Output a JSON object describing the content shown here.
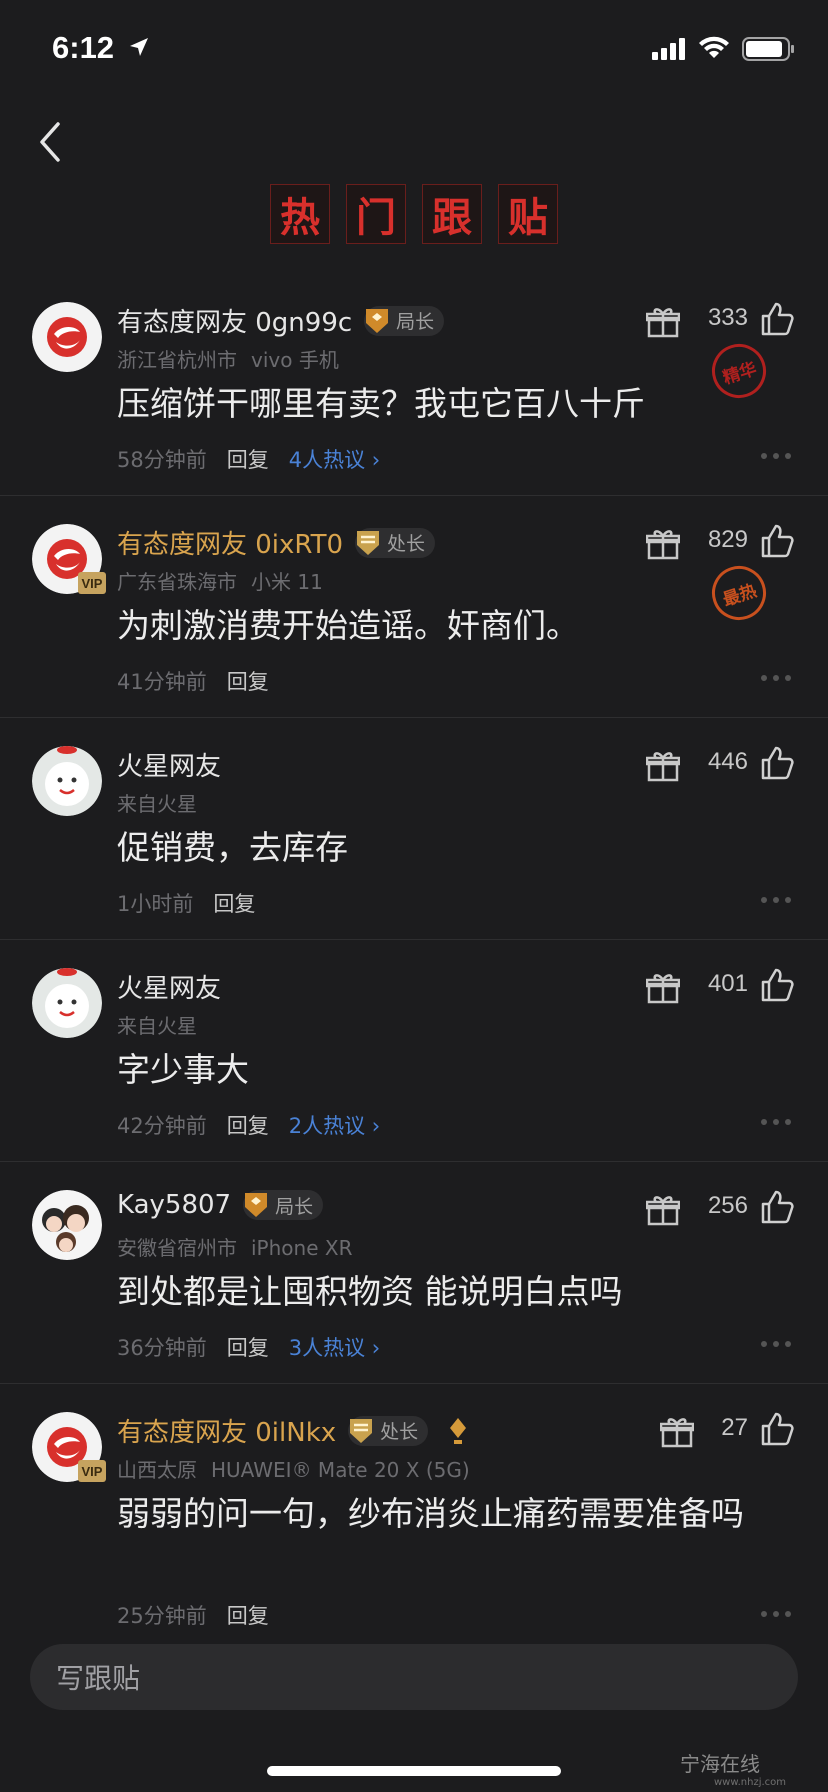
{
  "status_bar": {
    "time": "6:12"
  },
  "page_title_chars": [
    "热",
    "门",
    "跟",
    "贴"
  ],
  "comments": [
    {
      "username": "有态度网友 0gn99c",
      "vip": false,
      "rank": "局长",
      "location": "浙江省杭州市",
      "device": "vivo 手机",
      "text": "压缩饼干哪里有卖？我屯它百八十斤",
      "time": "58分钟前",
      "reply": "回复",
      "hot": "4人热议 ›",
      "likes": "333",
      "stamp": "精华"
    },
    {
      "username": "有态度网友 0ixRT0",
      "vip": true,
      "rank": "处长",
      "location": "广东省珠海市",
      "device": "小米 11",
      "text": "为刺激消费开始造谣。奸商们。",
      "time": "41分钟前",
      "reply": "回复",
      "hot": "",
      "likes": "829",
      "stamp": "最热"
    },
    {
      "username": "火星网友",
      "vip": false,
      "rank": "",
      "location": "来自火星",
      "device": "",
      "text": "促销费，去库存",
      "time": "1小时前",
      "reply": "回复",
      "hot": "",
      "likes": "446",
      "stamp": ""
    },
    {
      "username": "火星网友",
      "vip": false,
      "rank": "",
      "location": "来自火星",
      "device": "",
      "text": "字少事大",
      "time": "42分钟前",
      "reply": "回复",
      "hot": "2人热议 ›",
      "likes": "401",
      "stamp": ""
    },
    {
      "username": "Kay5807",
      "vip": false,
      "rank": "局长",
      "location": "安徽省宿州市",
      "device": "iPhone XR",
      "text": "到处都是让囤积物资 能说明白点吗",
      "time": "36分钟前",
      "reply": "回复",
      "hot": "3人热议 ›",
      "likes": "256",
      "stamp": ""
    },
    {
      "username": "有态度网友 0ilNkx",
      "vip": true,
      "rank": "处长",
      "location": "山西太原",
      "device": "HUAWEI® Mate 20 X (5G)",
      "text": "弱弱的问一句，纱布消炎止痛药需要准备吗",
      "time": "25分钟前",
      "reply": "回复",
      "hot": "",
      "likes": "27",
      "stamp": ""
    }
  ],
  "input_placeholder": "写跟贴",
  "watermark": {
    "name": "宁海在线",
    "url": "www.nhzj.com"
  },
  "colors": {
    "background": "#1c1c1e",
    "title_red": "#d8302c",
    "vip_gold": "#d9a44e",
    "link_blue": "#4a82d6"
  }
}
